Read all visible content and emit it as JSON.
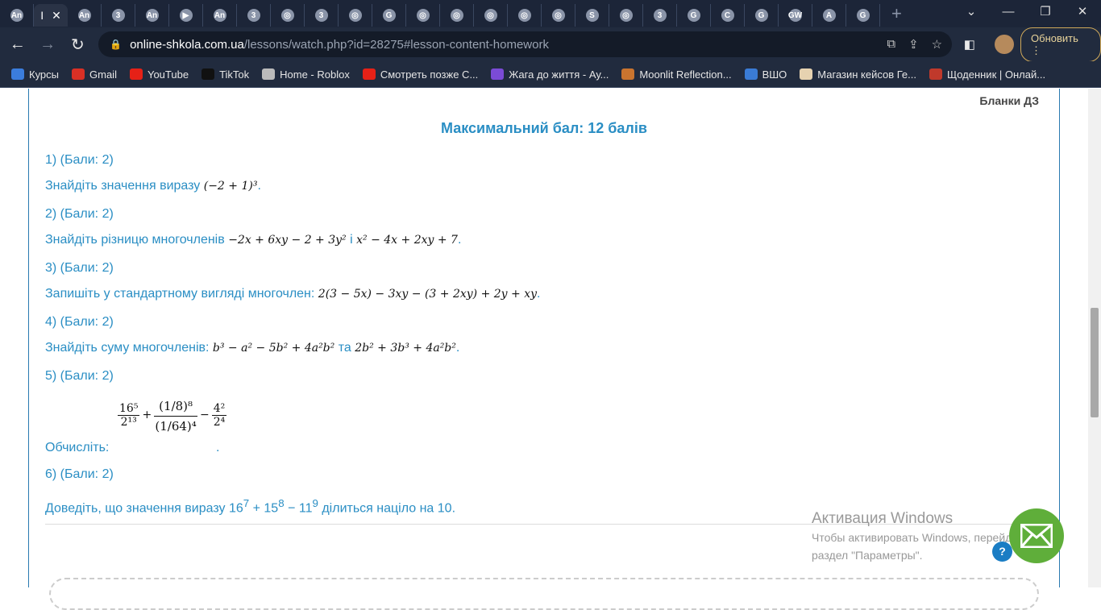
{
  "browser": {
    "tabs": [
      "An",
      "An",
      "3",
      "An",
      "▶",
      "An",
      "3",
      "◎",
      "3",
      "◎",
      "G",
      "◎",
      "◎",
      "◎",
      "◎",
      "◎",
      "S",
      "◎",
      "3",
      "G",
      "C",
      "G",
      "GW",
      "A",
      "G"
    ],
    "active_tab_label": "І",
    "url_host": "online-shkola.com.ua",
    "url_path": "/lessons/watch.php?id=28275#lesson-content-homework",
    "update_label": "Обновить",
    "bookmarks": [
      {
        "label": "Курсы",
        "color": "#3b7ddd"
      },
      {
        "label": "Gmail",
        "color": "#d93025"
      },
      {
        "label": "YouTube",
        "color": "#e62117"
      },
      {
        "label": "TikTok",
        "color": "#111111"
      },
      {
        "label": "Home - Roblox",
        "color": "#bbbbbb"
      },
      {
        "label": "Смотреть позже С...",
        "color": "#e62117"
      },
      {
        "label": "Жага до життя - Ау...",
        "color": "#7b4bd6"
      },
      {
        "label": "Moonlit Reflection...",
        "color": "#c9742f"
      },
      {
        "label": "ВШО",
        "color": "#3a7bd5"
      },
      {
        "label": "Магазин кейсов Ге...",
        "color": "#e6d2b0"
      },
      {
        "label": "Щоденник | Онлай...",
        "color": "#c0392b"
      }
    ]
  },
  "content": {
    "blanks_link": "Бланки ДЗ",
    "max_score": "Максимальний бал: 12 балів",
    "tasks": [
      {
        "header": "1) (Бали: 2)",
        "text": "Знайдіть значення виразу",
        "math": "(−2 + 1)³"
      },
      {
        "header": "2) (Бали: 2)",
        "text": "Знайдіть різницю многочленів",
        "math": "−2x + 6xy − 2 + 3y²",
        "joiner": "і",
        "math2": "x² − 4x + 2xy + 7"
      },
      {
        "header": "3) (Бали: 2)",
        "text": "Запишіть у стандартному вигляді многочлен:",
        "math": "2(3 − 5x) − 3xy − (3 + 2xy) + 2y + xy"
      },
      {
        "header": "4) (Бали: 2)",
        "text": "Знайдіть суму многочленів:",
        "math": "b³ − a² − 5b² + 4a²b²",
        "joiner": "та",
        "math2": "2b² + 3b³ + 4a²b²"
      },
      {
        "header": "5) (Бали: 2)",
        "text": "Обчисліть:",
        "f1n": "16⁵",
        "f1d": "2¹³",
        "f2n": "(1/8)⁸",
        "f2d": "(1/64)⁴",
        "f3n": "4²",
        "f3d": "2⁴"
      },
      {
        "header": "6) (Бали: 2)",
        "text_a": "Доведіть, що значення виразу 16",
        "e1": "7",
        "text_b": " + 15",
        "e2": "8",
        "text_c": " − 11",
        "e3": "9",
        "text_d": " ділиться націло на 10."
      }
    ]
  },
  "watermark": {
    "title": "Активация Windows",
    "line1": "Чтобы активировать Windows, перейдите в",
    "line2": "раздел \"Параметры\"."
  },
  "widgets": {
    "help": "?"
  }
}
